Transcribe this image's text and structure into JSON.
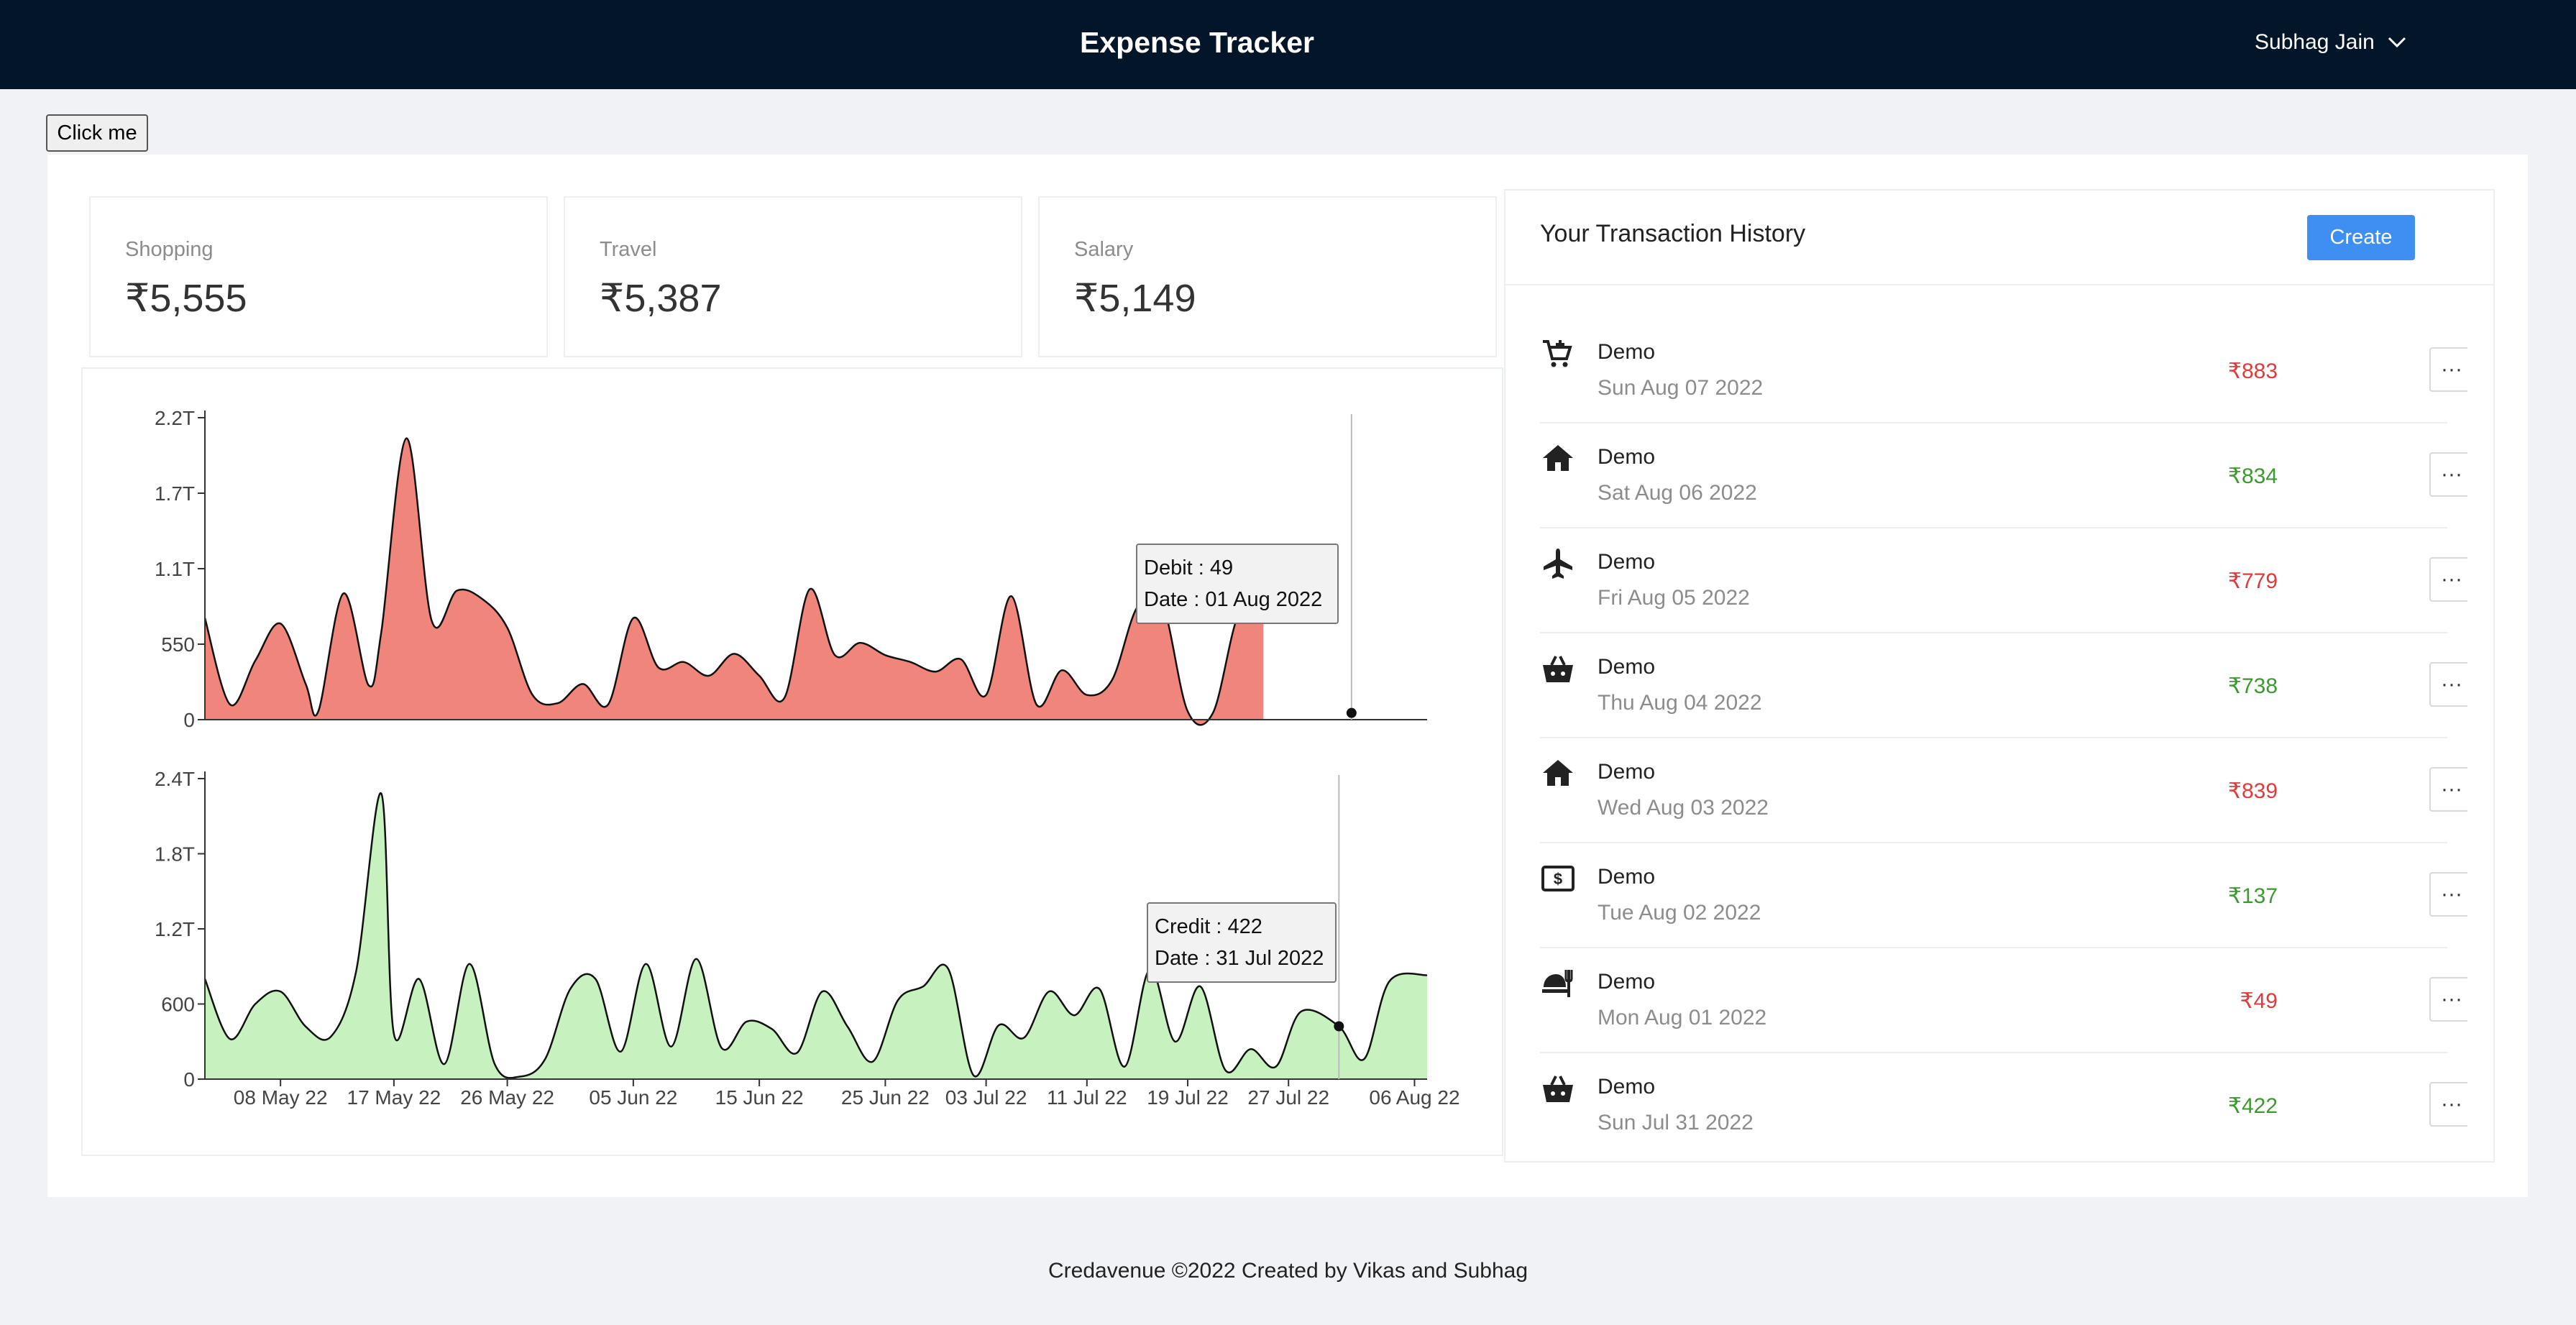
{
  "header": {
    "title": "Expense Tracker",
    "user": "Subhag Jain"
  },
  "actions": {
    "click_me": "Click me"
  },
  "cards": [
    {
      "label": "Shopping",
      "value": "₹5,555"
    },
    {
      "label": "Travel",
      "value": "₹5,387"
    },
    {
      "label": "Salary",
      "value": "₹5,149"
    }
  ],
  "transactions": {
    "title": "Your Transaction History",
    "create_label": "Create",
    "more_label": "···",
    "items": [
      {
        "icon": "cart-plus-icon",
        "name": "Demo",
        "date": "Sun Aug 07 2022",
        "amount": "₹883",
        "type": "debit"
      },
      {
        "icon": "home-icon",
        "name": "Demo",
        "date": "Sat Aug 06 2022",
        "amount": "₹834",
        "type": "credit"
      },
      {
        "icon": "airplane-icon",
        "name": "Demo",
        "date": "Fri Aug 05 2022",
        "amount": "₹779",
        "type": "debit"
      },
      {
        "icon": "shopping-basket-icon",
        "name": "Demo",
        "date": "Thu Aug 04 2022",
        "amount": "₹738",
        "type": "credit"
      },
      {
        "icon": "home-icon",
        "name": "Demo",
        "date": "Wed Aug 03 2022",
        "amount": "₹839",
        "type": "debit"
      },
      {
        "icon": "money-bill-icon",
        "name": "Demo",
        "date": "Tue Aug 02 2022",
        "amount": "₹137",
        "type": "credit"
      },
      {
        "icon": "food-icon",
        "name": "Demo",
        "date": "Mon Aug 01 2022",
        "amount": "₹49",
        "type": "debit"
      },
      {
        "icon": "shopping-basket-icon",
        "name": "Demo",
        "date": "Sun Jul 31 2022",
        "amount": "₹422",
        "type": "credit"
      }
    ]
  },
  "colors": {
    "debit_fill": "#f0857b",
    "credit_fill": "#c7f2bf",
    "debit_text": "#e23a3a",
    "credit_text": "#3a9a2e",
    "create_button": "#3f8ff2",
    "header_bg": "#021529"
  },
  "chart_data": [
    {
      "type": "area",
      "series": [
        {
          "name": "Debit"
        }
      ],
      "x": [
        "2022-05-02",
        "2022-05-04",
        "2022-05-06",
        "2022-05-08",
        "2022-05-10",
        "2022-05-11",
        "2022-05-13",
        "2022-05-15",
        "2022-05-16",
        "2022-05-18",
        "2022-05-20",
        "2022-05-22",
        "2022-05-24",
        "2022-05-26",
        "2022-05-28",
        "2022-05-30",
        "2022-06-01",
        "2022-06-03",
        "2022-06-05",
        "2022-06-07",
        "2022-06-09",
        "2022-06-11",
        "2022-06-13",
        "2022-06-15",
        "2022-06-17",
        "2022-06-19",
        "2022-06-21",
        "2022-06-23",
        "2022-06-25",
        "2022-06-27",
        "2022-06-29",
        "2022-07-01",
        "2022-07-03",
        "2022-07-05",
        "2022-07-07",
        "2022-07-09",
        "2022-07-11",
        "2022-07-13",
        "2022-07-15",
        "2022-07-17",
        "2022-07-19",
        "2022-07-21",
        "2022-07-23",
        "2022-07-25",
        "2022-07-27",
        "2022-07-29",
        "2022-07-31",
        "2022-08-01",
        "2022-08-03",
        "2022-08-05",
        "2022-08-07"
      ],
      "values": [
        740,
        110,
        430,
        700,
        260,
        60,
        920,
        250,
        640,
        2050,
        720,
        940,
        880,
        670,
        180,
        120,
        260,
        110,
        740,
        380,
        420,
        320,
        480,
        320,
        160,
        950,
        470,
        560,
        470,
        420,
        350,
        440,
        180,
        900,
        110,
        360,
        180,
        290,
        820,
        840,
        60,
        49,
        760,
        880
      ],
      "yticks": [
        "0",
        "550",
        "1.1T",
        "1.7T",
        "2.2T"
      ],
      "ylim": [
        0,
        2200
      ],
      "tooltip": {
        "line1": "Debit : 49",
        "line2": "Date : 01 Aug 2022"
      }
    },
    {
      "type": "area",
      "series": [
        {
          "name": "Credit"
        }
      ],
      "x": [
        "2022-05-02",
        "2022-05-04",
        "2022-05-06",
        "2022-05-08",
        "2022-05-10",
        "2022-05-12",
        "2022-05-14",
        "2022-05-16",
        "2022-05-17",
        "2022-05-19",
        "2022-05-21",
        "2022-05-23",
        "2022-05-25",
        "2022-05-27",
        "2022-05-29",
        "2022-05-31",
        "2022-06-02",
        "2022-06-04",
        "2022-06-06",
        "2022-06-08",
        "2022-06-10",
        "2022-06-12",
        "2022-06-14",
        "2022-06-16",
        "2022-06-18",
        "2022-06-20",
        "2022-06-22",
        "2022-06-24",
        "2022-06-26",
        "2022-06-28",
        "2022-06-30",
        "2022-07-02",
        "2022-07-04",
        "2022-07-06",
        "2022-07-08",
        "2022-07-10",
        "2022-07-12",
        "2022-07-14",
        "2022-07-16",
        "2022-07-18",
        "2022-07-20",
        "2022-07-22",
        "2022-07-24",
        "2022-07-26",
        "2022-07-28",
        "2022-07-31",
        "2022-08-02",
        "2022-08-04",
        "2022-08-07"
      ],
      "values": [
        800,
        320,
        600,
        700,
        420,
        340,
        860,
        2280,
        360,
        800,
        120,
        920,
        120,
        20,
        160,
        720,
        800,
        220,
        920,
        260,
        960,
        250,
        460,
        400,
        210,
        700,
        420,
        140,
        630,
        740,
        880,
        30,
        430,
        330,
        700,
        510,
        720,
        100,
        880,
        300,
        740,
        70,
        240,
        100,
        540,
        422,
        160,
        780,
        830
      ],
      "yticks": [
        "0",
        "600",
        "1.2T",
        "1.8T",
        "2.4T"
      ],
      "ylim": [
        0,
        2400
      ],
      "xticks": [
        "08 May 22",
        "17 May 22",
        "26 May 22",
        "05 Jun 22",
        "15 Jun 22",
        "25 Jun 22",
        "03 Jul 22",
        "11 Jul 22",
        "19 Jul 22",
        "27 Jul 22",
        "06 Aug 22"
      ],
      "tooltip": {
        "line1": "Credit : 422",
        "line2": "Date : 31 Jul 2022"
      }
    }
  ],
  "footer": {
    "text": "Credavenue ©2022 Created by Vikas and Subhag"
  }
}
